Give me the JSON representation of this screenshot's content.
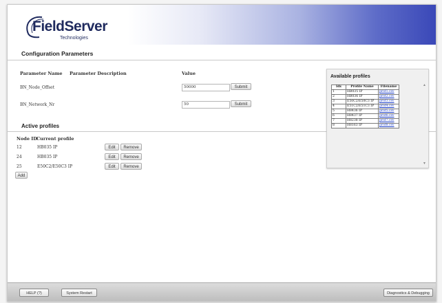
{
  "logo": {
    "name": "FieldServer",
    "tagline": "Technologies"
  },
  "config": {
    "title": "Configuration Parameters",
    "headers": {
      "name": "Parameter Name",
      "description": "Parameter Description",
      "value": "Value"
    },
    "params": [
      {
        "name": "BN_Node_Offset",
        "description": "",
        "value": "50000",
        "submit": "Submit"
      },
      {
        "name": "BN_Network_Nr",
        "description": "",
        "value": "50",
        "submit": "Submit"
      }
    ]
  },
  "active": {
    "title": "Active profiles",
    "headers": {
      "node": "Node ID",
      "profile": "Current profile"
    },
    "rows": [
      {
        "node": "12",
        "profile": "HB035 IP",
        "edit": "Edit",
        "remove": "Remove"
      },
      {
        "node": "24",
        "profile": "HB035 IP",
        "edit": "Edit",
        "remove": "Remove"
      },
      {
        "node": "25",
        "profile": "E50C2/E50C3 IP",
        "edit": "Edit",
        "remove": "Remove"
      }
    ],
    "add": "Add"
  },
  "available": {
    "title": "Available profiles",
    "headers": {
      "idx": "Idx",
      "name": "Profile Name",
      "file": "Filename"
    },
    "rows": [
      {
        "idx": "1",
        "name": "HB035 IP",
        "file": "prof1.csv"
      },
      {
        "idx": "2",
        "name": "HB036 IP",
        "file": "prof2.csv"
      },
      {
        "idx": "3",
        "name": "E50C2/E50C3 IP",
        "file": "prof3.csv"
      },
      {
        "idx": "4",
        "name": "E51C2/E51C3 IP",
        "file": "prof4.csv"
      },
      {
        "idx": "5",
        "name": "H8436 IP",
        "file": "prof5.csv"
      },
      {
        "idx": "6",
        "name": "H8437 IP",
        "file": "prof6.csv"
      },
      {
        "idx": "7",
        "name": "H8238 IP",
        "file": "prof7.csv"
      },
      {
        "idx": "8",
        "name": "H8163 IP",
        "file": "prof8.csv"
      }
    ]
  },
  "footer": {
    "help": "HELP (?)",
    "restart": "System Restart",
    "diagnostics": "Diagnostics & Debugging"
  },
  "colors": {
    "header_blue": "#3a48b8",
    "logo_navy": "#1f2a5e",
    "link": "#1a3cc8"
  }
}
